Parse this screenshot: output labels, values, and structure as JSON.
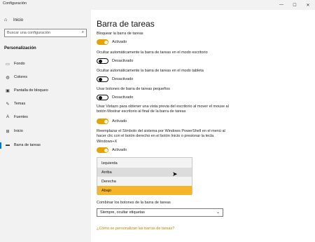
{
  "window": {
    "title": "Configuración",
    "minimize_glyph": "—",
    "maximize_glyph": "☐",
    "close_glyph": "✕"
  },
  "sidebar": {
    "home_label": "Inicio",
    "search_placeholder": "Buscar una configuración",
    "section_title": "Personalización",
    "items": [
      {
        "label": "Fondo",
        "icon": "image-icon",
        "glyph": "▭"
      },
      {
        "label": "Colores",
        "icon": "palette-icon",
        "glyph": "◍"
      },
      {
        "label": "Pantalla de bloqueo",
        "icon": "lock-screen-icon",
        "glyph": "▣"
      },
      {
        "label": "Temas",
        "icon": "brush-icon",
        "glyph": "✎"
      },
      {
        "label": "Fuentes",
        "icon": "font-icon",
        "glyph": "A"
      },
      {
        "label": "Inicio",
        "icon": "start-icon",
        "glyph": "⊞"
      },
      {
        "label": "Barra de tareas",
        "icon": "taskbar-icon",
        "glyph": "▬"
      }
    ],
    "active_item": "Barra de tareas"
  },
  "main": {
    "title": "Barra de tareas",
    "settings": [
      {
        "label": "Bloquear la barra de tareas",
        "state": "Activado",
        "on": true
      },
      {
        "label": "Ocultar automáticamente la barra de tareas en el modo escritorio",
        "state": "Desactivado",
        "on": false
      },
      {
        "label": "Ocultar automáticamente la barra de tareas en el modo tableta",
        "state": "Desactivado",
        "on": false
      },
      {
        "label": "Usar botones de barra de tareas pequeños",
        "state": "Desactivado",
        "on": false
      },
      {
        "label": "Usar Vistazo para obtener una vista previa del escritorio al mover el mouse al botón Mostrar escritorio al final de la barra de tareas",
        "state": "Activado",
        "on": true
      },
      {
        "label": "Reemplazar el Símbolo del sistema por Windows PowerShell en el menú al hacer clic con el botón derecho en el botón Inicio o presionar la tecla Windows+X",
        "state": "Activado",
        "on": true
      }
    ],
    "location_options": [
      "Izquierda",
      "Arriba",
      "Derecha",
      "Abajo"
    ],
    "location_selected": "Abajo",
    "location_hovered": "Arriba",
    "combine_label": "Combinar los botones de la barra de tareas",
    "combine_value": "Siempre, ocultar etiquetas",
    "help_link": "¿Cómo se personalizan las barras de tareas?"
  },
  "colors": {
    "accent": "#e6a300",
    "selected": "#f5b52a",
    "sidebar_bg": "#f2f2f2",
    "link": "#c18400"
  }
}
